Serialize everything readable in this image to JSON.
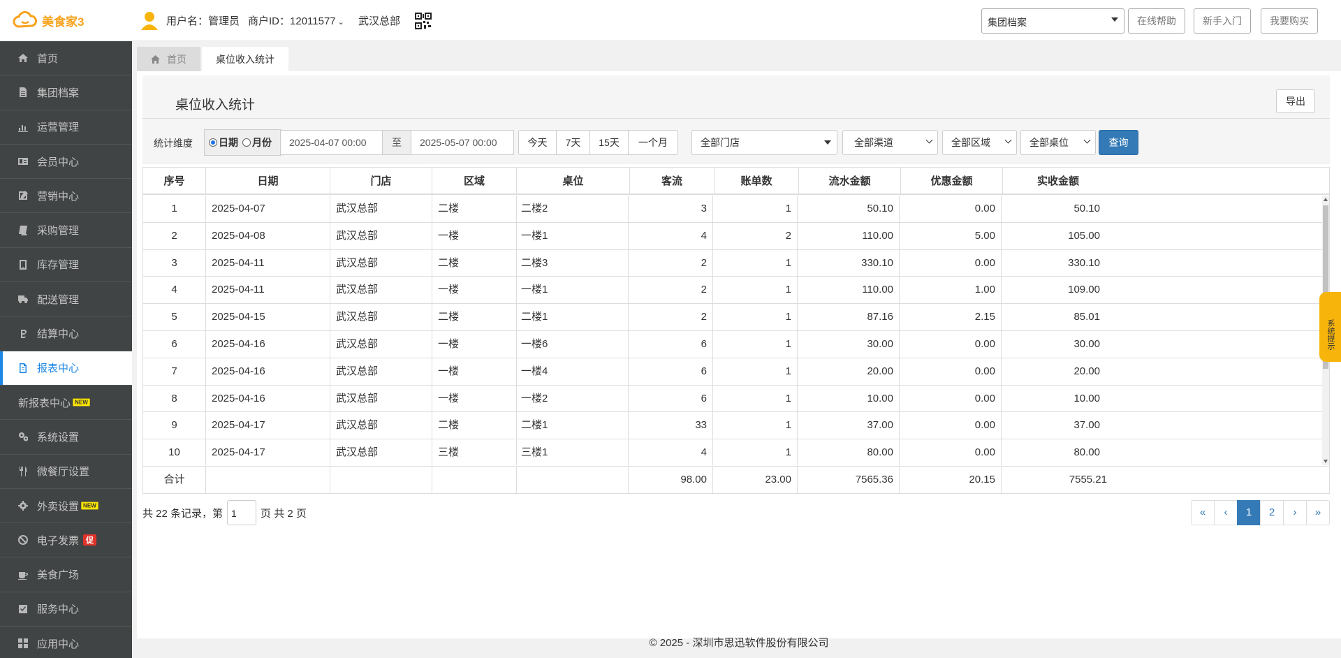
{
  "header": {
    "logo_text": "美食家3",
    "user_label": "用户名：管理员",
    "merchant_label": "商户ID：12011577",
    "store": "武汉总部",
    "archive_select": "集团档案",
    "buttons": [
      "在线帮助",
      "新手入门",
      "我要购买"
    ]
  },
  "sidebar": {
    "items": [
      {
        "label": "首页",
        "icon": "home-icon"
      },
      {
        "label": "集团档案",
        "icon": "file-icon"
      },
      {
        "label": "运营管理",
        "icon": "bar-chart-icon"
      },
      {
        "label": "会员中心",
        "icon": "id-card-icon"
      },
      {
        "label": "营销中心",
        "icon": "edit-icon"
      },
      {
        "label": "采购管理",
        "icon": "book-icon"
      },
      {
        "label": "库存管理",
        "icon": "box-icon"
      },
      {
        "label": "配送管理",
        "icon": "truck-icon"
      },
      {
        "label": "结算中心",
        "icon": "bitcoin-icon"
      },
      {
        "label": "报表中心",
        "icon": "report-icon"
      },
      {
        "label": "新报表中心",
        "icon": "",
        "badge": "NEW"
      },
      {
        "label": "系统设置",
        "icon": "gears-icon"
      },
      {
        "label": "微餐厅设置",
        "icon": "cutlery-icon"
      },
      {
        "label": "外卖设置",
        "icon": "gear-icon",
        "badge": "NEW"
      },
      {
        "label": "电子发票",
        "icon": "ban-icon",
        "badge_promo": "促"
      },
      {
        "label": "美食广场",
        "icon": "cup-icon"
      },
      {
        "label": "服务中心",
        "icon": "check-square-icon"
      },
      {
        "label": "应用中心",
        "icon": "apps-icon"
      }
    ],
    "active_index": 9
  },
  "tabs": [
    {
      "label": "首页",
      "icon": "home-icon"
    },
    {
      "label": "桌位收入统计"
    }
  ],
  "page": {
    "title": "桌位收入统计",
    "export_label": "导出"
  },
  "filters": {
    "dimension_label": "统计维度",
    "radio_day": "日期",
    "radio_month": "月份",
    "date_from": "2025-04-07 00:00",
    "to_label": "至",
    "date_to": "2025-05-07 00:00",
    "quick": [
      "今天",
      "7天",
      "15天",
      "一个月"
    ],
    "store": "全部门店",
    "channel": "全部渠道",
    "area": "全部区域",
    "table": "全部桌位",
    "query_label": "查询"
  },
  "table": {
    "columns": [
      "序号",
      "日期",
      "门店",
      "区域",
      "桌位",
      "客流",
      "账单数",
      "流水金额",
      "优惠金额",
      "实收金额"
    ],
    "rows": [
      [
        "1",
        "2025-04-07",
        "武汉总部",
        "二楼",
        "二楼2",
        "3",
        "1",
        "50.10",
        "0.00",
        "50.10"
      ],
      [
        "2",
        "2025-04-08",
        "武汉总部",
        "一楼",
        "一楼1",
        "4",
        "2",
        "110.00",
        "5.00",
        "105.00"
      ],
      [
        "3",
        "2025-04-11",
        "武汉总部",
        "二楼",
        "二楼3",
        "2",
        "1",
        "330.10",
        "0.00",
        "330.10"
      ],
      [
        "4",
        "2025-04-11",
        "武汉总部",
        "一楼",
        "一楼1",
        "2",
        "1",
        "110.00",
        "1.00",
        "109.00"
      ],
      [
        "5",
        "2025-04-15",
        "武汉总部",
        "二楼",
        "二楼1",
        "2",
        "1",
        "87.16",
        "2.15",
        "85.01"
      ],
      [
        "6",
        "2025-04-16",
        "武汉总部",
        "一楼",
        "一楼6",
        "6",
        "1",
        "30.00",
        "0.00",
        "30.00"
      ],
      [
        "7",
        "2025-04-16",
        "武汉总部",
        "一楼",
        "一楼4",
        "6",
        "1",
        "20.00",
        "0.00",
        "20.00"
      ],
      [
        "8",
        "2025-04-16",
        "武汉总部",
        "一楼",
        "一楼2",
        "6",
        "1",
        "10.00",
        "0.00",
        "10.00"
      ],
      [
        "9",
        "2025-04-17",
        "武汉总部",
        "二楼",
        "二楼1",
        "33",
        "1",
        "37.00",
        "0.00",
        "37.00"
      ],
      [
        "10",
        "2025-04-17",
        "武汉总部",
        "三楼",
        "三楼1",
        "4",
        "1",
        "80.00",
        "0.00",
        "80.00"
      ]
    ],
    "footer": [
      "合计",
      "",
      "",
      "",
      "",
      "98.00",
      "23.00",
      "7565.36",
      "20.15",
      "7555.21"
    ]
  },
  "pagination": {
    "info_prefix": "共 22 条记录，第",
    "current_page": "1",
    "info_suffix": "页 共 2 页",
    "buttons": [
      "«",
      "‹",
      "1",
      "2",
      "›",
      "»"
    ],
    "active": "1"
  },
  "footer": "© 2025 - 深圳市思迅软件股份有限公司",
  "sys_tip": "系统提示",
  "colors": {
    "accent": "#337ab7",
    "sidebar_bg": "#414445",
    "sidebar_active": "#1e88e5",
    "logo": "#f7a21b",
    "tip": "#f7b50c"
  }
}
